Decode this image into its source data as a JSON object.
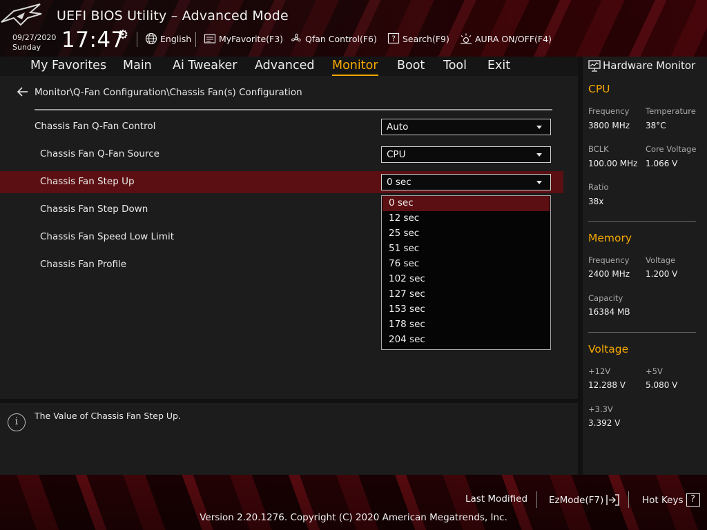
{
  "header": {
    "title": "UEFI BIOS Utility – Advanced Mode",
    "date": "09/27/2020",
    "day": "Sunday",
    "time": "17:47",
    "tools": {
      "language": "English",
      "my_favorite": "MyFavorite(F3)",
      "qfan": "Qfan Control(F6)",
      "search": "Search(F9)",
      "aura": "AURA ON/OFF(F4)"
    }
  },
  "nav": {
    "items": [
      "My Favorites",
      "Main",
      "Ai Tweaker",
      "Advanced",
      "Monitor",
      "Boot",
      "Tool",
      "Exit"
    ],
    "active": "Monitor"
  },
  "breadcrumb": "Monitor\\Q-Fan Configuration\\Chassis Fan(s) Configuration",
  "settings": [
    {
      "label": "Chassis Fan Q-Fan Control",
      "value": "Auto"
    },
    {
      "label": "Chassis Fan Q-Fan Source",
      "value": "CPU"
    },
    {
      "label": "Chassis Fan Step Up",
      "value": "0 sec"
    },
    {
      "label": "Chassis Fan Step Down",
      "value": ""
    },
    {
      "label": "Chassis Fan Speed Low Limit",
      "value": ""
    },
    {
      "label": "Chassis Fan Profile",
      "value": ""
    }
  ],
  "dropdown": {
    "options": [
      "0 sec",
      "12 sec",
      "25 sec",
      "51 sec",
      "76 sec",
      "102 sec",
      "127 sec",
      "153 sec",
      "178 sec",
      "204 sec"
    ],
    "selected": "0 sec"
  },
  "help": {
    "text": "The Value of Chassis Fan Step Up."
  },
  "hardware_monitor": {
    "title": "Hardware Monitor",
    "cpu": {
      "heading": "CPU",
      "frequency_label": "Frequency",
      "frequency": "3800 MHz",
      "temperature_label": "Temperature",
      "temperature": "38°C",
      "bclk_label": "BCLK",
      "bclk": "100.00 MHz",
      "core_voltage_label": "Core Voltage",
      "core_voltage": "1.066 V",
      "ratio_label": "Ratio",
      "ratio": "38x"
    },
    "memory": {
      "heading": "Memory",
      "frequency_label": "Frequency",
      "frequency": "2400 MHz",
      "voltage_label": "Voltage",
      "voltage": "1.200 V",
      "capacity_label": "Capacity",
      "capacity": "16384 MB"
    },
    "voltage": {
      "heading": "Voltage",
      "v12_label": "+12V",
      "v12": "12.288 V",
      "v5_label": "+5V",
      "v5": "5.080 V",
      "v33_label": "+3.3V",
      "v33": "3.392 V"
    }
  },
  "footer": {
    "last_modified": "Last Modified",
    "ezmode": "EzMode(F7)",
    "hotkeys": "Hot Keys",
    "hotkeys_key": "?",
    "copyright": "Version 2.20.1276. Copyright (C) 2020 American Megatrends, Inc."
  },
  "colors": {
    "accent": "#f6a800",
    "highlight_row": "#5c0f12",
    "panel": "#1c1c1c"
  }
}
